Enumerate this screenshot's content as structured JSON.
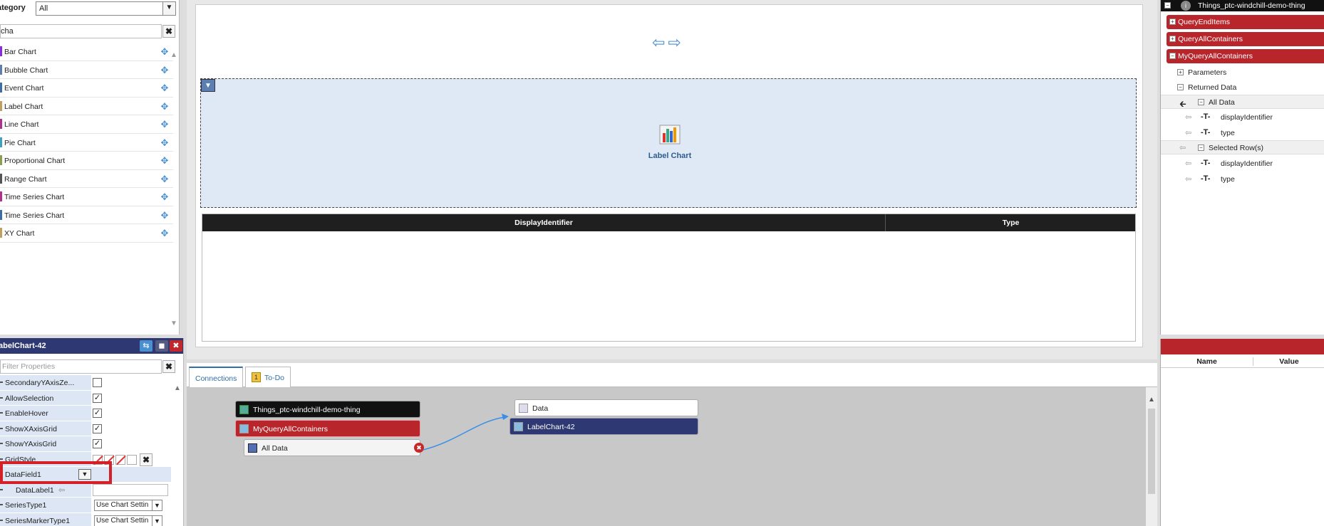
{
  "widgets_panel": {
    "category_label": "ategory",
    "category_value": "All",
    "filter_value": "cha",
    "items": [
      {
        "label": "Bar Chart",
        "color": "#8a2be2"
      },
      {
        "label": "Bubble Chart",
        "color": "#5a7fb0"
      },
      {
        "label": "Event Chart",
        "color": "#3a6ea5"
      },
      {
        "label": "Label Chart",
        "color": "#c0a060"
      },
      {
        "label": "Line Chart",
        "color": "#b03090"
      },
      {
        "label": "Pie Chart",
        "color": "#40a0c0"
      },
      {
        "label": "Proportional Chart",
        "color": "#8aa050"
      },
      {
        "label": "Range Chart",
        "color": "#555555"
      },
      {
        "label": "Time Series Chart",
        "color": "#b03090"
      },
      {
        "label": "Time Series Chart",
        "color": "#3a6ea5"
      },
      {
        "label": "XY Chart",
        "color": "#c0a060"
      }
    ]
  },
  "properties_panel": {
    "title": "abelChart-42",
    "filter_placeholder": "Filter Properties",
    "rows": [
      {
        "label": "SecondaryYAxisZe...",
        "type": "check",
        "checked": false
      },
      {
        "label": "AllowSelection",
        "type": "check",
        "checked": true
      },
      {
        "label": "EnableHover",
        "type": "check",
        "checked": true
      },
      {
        "label": "ShowXAxisGrid",
        "type": "check",
        "checked": true
      },
      {
        "label": "ShowYAxisGrid",
        "type": "check",
        "checked": true
      },
      {
        "label": "GridStyle",
        "type": "style"
      },
      {
        "label": "DataField1",
        "type": "dropdown"
      },
      {
        "label": "DataLabel1",
        "type": "text"
      },
      {
        "label": "SeriesType1",
        "type": "select",
        "value": "Use Chart Settin"
      },
      {
        "label": "SeriesMarkerType1",
        "type": "select",
        "value": "Use Chart Settin"
      }
    ],
    "check_mark": "✓"
  },
  "mashup": {
    "nav_arrows": "⇦⇨",
    "chart_widget_label": "Label Chart",
    "grid_columns": [
      "DisplayIdentifier",
      "Type"
    ]
  },
  "entity_tree": {
    "thing_name": "Things_ptc-windchill-demo-thing",
    "services": [
      "QueryEndItems",
      "QueryAllContainers",
      "MyQueryAllContainers"
    ],
    "parameters_label": "Parameters",
    "returned_data_label": "Returned Data",
    "all_data_label": "All Data",
    "selected_rows_label": "Selected Row(s)",
    "fields": [
      "displayIdentifier",
      "type"
    ]
  },
  "binding_panel": {
    "columns": [
      "Name",
      "Value"
    ]
  },
  "connections": {
    "tabs": [
      "Connections",
      "To-Do"
    ],
    "source_thing": "Things_ptc-windchill-demo-thing",
    "source_service": "MyQueryAllContainers",
    "source_output": "All Data",
    "target_property": "Data",
    "target_widget": "LabelChart-42"
  }
}
